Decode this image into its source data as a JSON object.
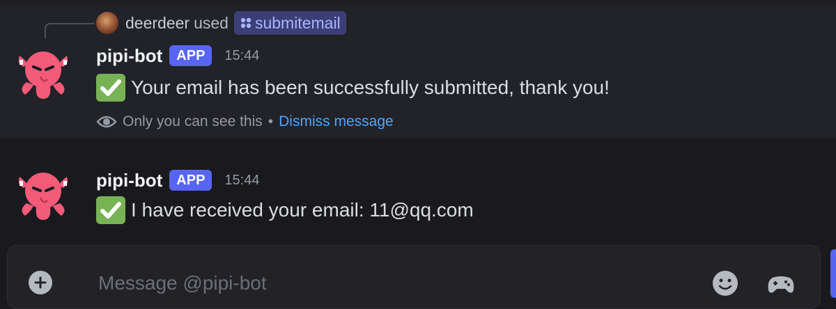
{
  "interaction": {
    "user": "deerdeer",
    "action_text": "used",
    "command": "submitemail"
  },
  "messages": [
    {
      "author": "pipi-bot",
      "badge": "APP",
      "time": "15:44",
      "text": "Your email has been successfully submitted, thank you!",
      "ephemeral_note": "Only you can see this",
      "separator": "•",
      "dismiss_label": "Dismiss message"
    },
    {
      "author": "pipi-bot",
      "badge": "APP",
      "time": "15:44",
      "text": "I have received your email: 11@qq.com"
    }
  ],
  "composer": {
    "placeholder": "Message @pipi-bot"
  },
  "colors": {
    "app_badge": "#5865f2",
    "avatar_pink": "#f45b79",
    "link_blue": "#4da6ff",
    "check_green": "#77b255"
  },
  "icons": {
    "reaction": "white-check-mark-icon",
    "eye": "eye-icon",
    "command": "slash-command-icon",
    "add": "plus-circle-icon",
    "emoji": "smiley-icon",
    "gamepad": "gamepad-icon"
  }
}
